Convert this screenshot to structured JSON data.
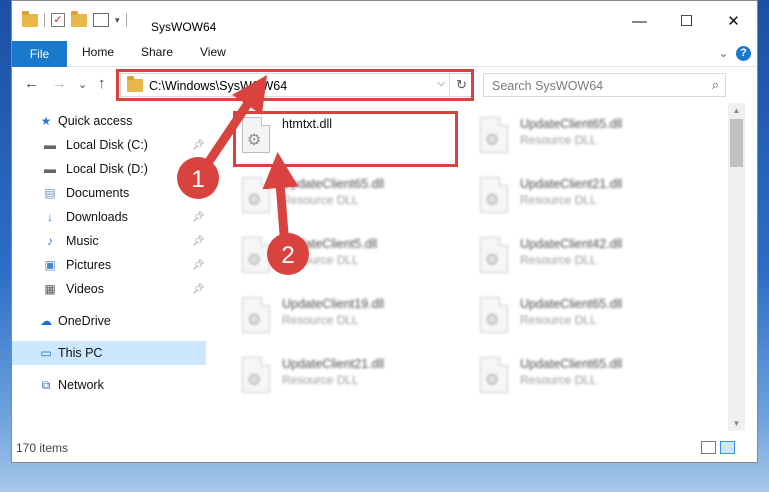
{
  "window": {
    "title": "SysWOW64",
    "controls": {
      "minimize": "—",
      "maximize": "☐",
      "close": "✕"
    }
  },
  "ribbon": {
    "tabs": [
      {
        "label": "File"
      },
      {
        "label": "Home"
      },
      {
        "label": "Share"
      },
      {
        "label": "View"
      }
    ],
    "expand_glyph": "⌄",
    "help_glyph": "?"
  },
  "address": {
    "path": "C:\\Windows\\SysWOW64",
    "dropdown_glyph": "⌵",
    "refresh_glyph": "↻"
  },
  "search": {
    "placeholder": "Search SysWOW64"
  },
  "nav": {
    "back": "←",
    "forward": "→",
    "recent": "⌄",
    "up": "↑"
  },
  "sidebar": {
    "items": [
      {
        "label": "Quick access",
        "icon": "star-icon"
      },
      {
        "label": "Local Disk (C:)",
        "icon": "drive-icon"
      },
      {
        "label": "Local Disk (D:)",
        "icon": "drive-icon"
      },
      {
        "label": "Documents",
        "icon": "documents-icon"
      },
      {
        "label": "Downloads",
        "icon": "download-icon"
      },
      {
        "label": "Music",
        "icon": "music-icon"
      },
      {
        "label": "Pictures",
        "icon": "pictures-icon"
      },
      {
        "label": "Videos",
        "icon": "videos-icon"
      },
      {
        "label": "OneDrive",
        "icon": "cloud-icon"
      },
      {
        "label": "This PC",
        "icon": "computer-icon"
      },
      {
        "label": "Network",
        "icon": "network-icon"
      }
    ]
  },
  "files": [
    {
      "name": "htmtxt.dll",
      "type": ""
    },
    {
      "name": "UpdateClient65.dll",
      "type": "Resource DLL"
    },
    {
      "name": "UpdateClient65.dll",
      "type": "Resource DLL"
    },
    {
      "name": "UpdateClient21.dll",
      "type": "Resource DLL"
    },
    {
      "name": "UpdateClient5.dll",
      "type": "Resource DLL"
    },
    {
      "name": "UpdateClient42.dll",
      "type": "Resource DLL"
    },
    {
      "name": "UpdateClient19.dll",
      "type": "Resource DLL"
    },
    {
      "name": "UpdateClient65.dll",
      "type": "Resource DLL"
    },
    {
      "name": "UpdateClient21.dll",
      "type": "Resource DLL"
    },
    {
      "name": "UpdateClient65.dll",
      "type": "Resource DLL"
    }
  ],
  "status": {
    "items_count": "170 items"
  },
  "annotations": {
    "step1": "1",
    "step2": "2",
    "color": "#d8433f"
  }
}
